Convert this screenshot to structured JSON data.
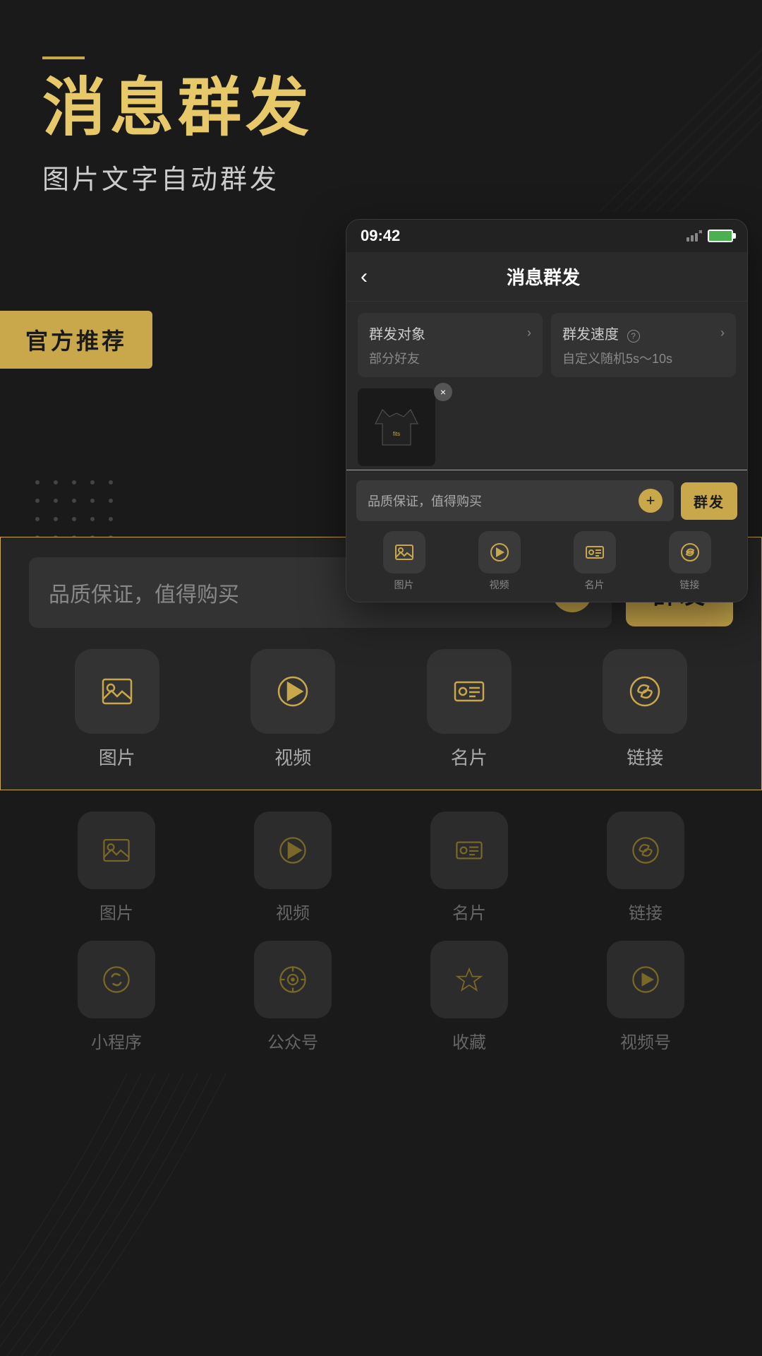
{
  "app": {
    "background_color": "#1a1a1a",
    "accent_color": "#c9a84c"
  },
  "header": {
    "dash": "—",
    "main_title": "消息群发",
    "sub_title": "图片文字自动群发",
    "official_badge": "官方推荐"
  },
  "phone_mockup": {
    "status_bar": {
      "time": "09:42",
      "battery": "🔋"
    },
    "navbar": {
      "back_icon": "‹",
      "title": "消息群发"
    },
    "settings": {
      "target_label": "群发对象",
      "target_value": "部分好友",
      "speed_label": "群发速度",
      "speed_help": "?",
      "speed_value": "自定义随机5s～10s"
    },
    "preview_image_alt": "T-shirt product image",
    "close_btn": "×",
    "input_panel": {
      "placeholder": "品质保证，值得购买",
      "plus_label": "+",
      "send_label": "群发",
      "media_items": [
        {
          "icon": "image",
          "label": "图片"
        },
        {
          "icon": "video",
          "label": "视频"
        },
        {
          "icon": "card",
          "label": "名片"
        },
        {
          "icon": "link",
          "label": "链接"
        }
      ]
    }
  },
  "main_panel": {
    "input": {
      "placeholder": "品质保证，值得购买",
      "plus_label": "+",
      "send_label": "群发"
    },
    "media_row1": [
      {
        "icon": "image",
        "label": "图片"
      },
      {
        "icon": "video",
        "label": "视频"
      },
      {
        "icon": "card",
        "label": "名片"
      },
      {
        "icon": "link",
        "label": "链接"
      }
    ],
    "media_row2": [
      {
        "icon": "image",
        "label": "图片"
      },
      {
        "icon": "video",
        "label": "视频"
      },
      {
        "icon": "card",
        "label": "名片"
      },
      {
        "icon": "link",
        "label": "链接"
      }
    ],
    "media_row3": [
      {
        "icon": "mini-program",
        "label": "小程序"
      },
      {
        "icon": "official-account",
        "label": "公众号"
      },
      {
        "icon": "favorites",
        "label": "收藏"
      },
      {
        "icon": "video-account",
        "label": "视频号"
      }
    ]
  }
}
